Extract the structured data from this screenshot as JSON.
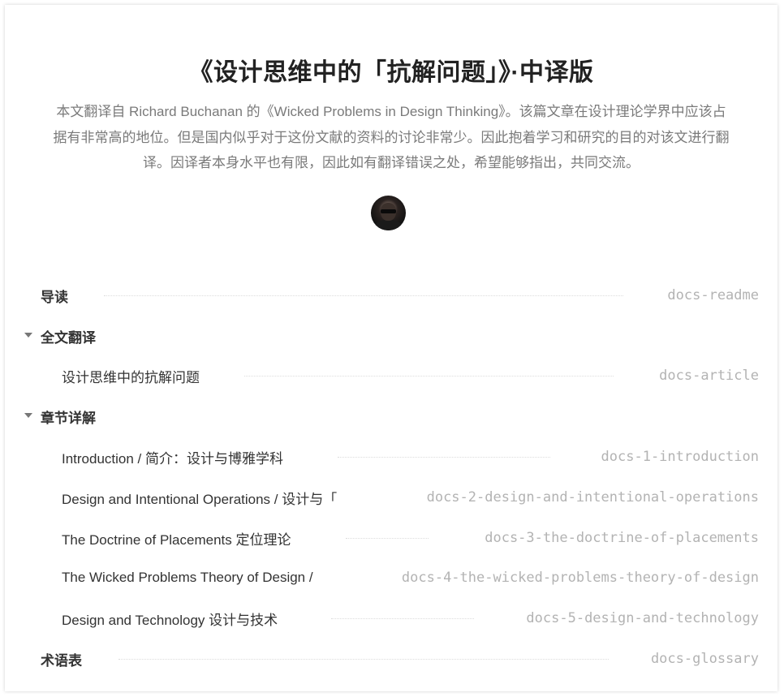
{
  "article": {
    "title": "《设计思维中的「抗解问题」》·中译版",
    "description_lines": [
      "本文翻译自 Richard Buchanan 的《Wicked Problems in Design Thinking》。该篇文章在设计理论学界中应该占",
      "据有非常高的地位。但是国内似乎对于这份文献的资料的讨论非常少。因此抱着学习和研究的目的对该文进行翻",
      "译。因译者本身水平也有限，因此如有翻译错误之处，希望能够指出，共同交流。"
    ]
  },
  "toc": {
    "readme": {
      "label": "导读",
      "slug": "docs-readme"
    },
    "full_translation": {
      "label": "全文翻译"
    },
    "article": {
      "label": "设计思维中的抗解问题",
      "slug": "docs-article"
    },
    "chapters": {
      "label": "章节详解"
    },
    "ch1": {
      "label": "Introduction / 简介：设计与博雅学科",
      "slug": "docs-1-introduction"
    },
    "ch2": {
      "label": "Design and Intentional Operations / 设计与「",
      "slug": "docs-2-design-and-intentional-operations"
    },
    "ch3": {
      "label": "The Doctrine of Placements 定位理论",
      "slug": "docs-3-the-doctrine-of-placements"
    },
    "ch4": {
      "label": "The Wicked Problems Theory of Design /",
      "slug": "docs-4-the-wicked-problems-theory-of-design"
    },
    "ch5": {
      "label": "Design and Technology 设计与技术",
      "slug": "docs-5-design-and-technology"
    },
    "glossary": {
      "label": "术语表",
      "slug": "docs-glossary"
    }
  }
}
